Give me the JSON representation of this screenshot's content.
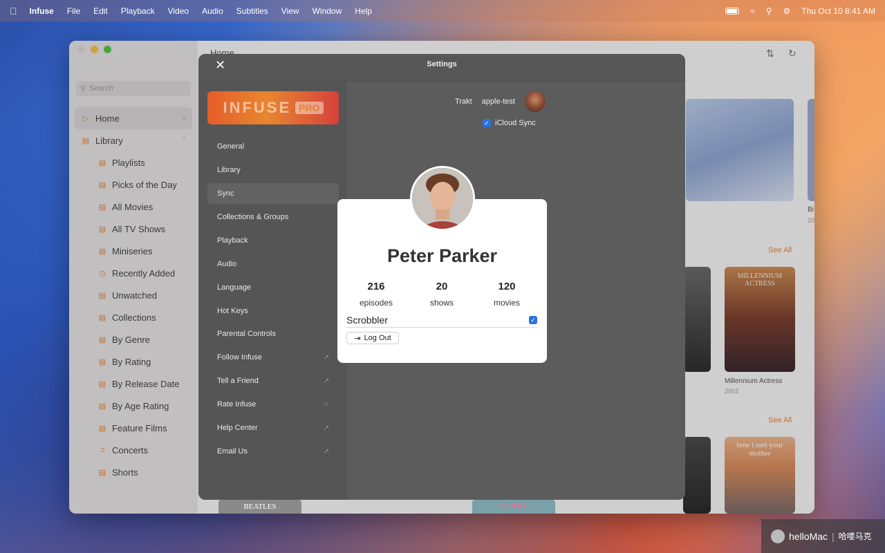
{
  "menubar": {
    "app": "Infuse",
    "items": [
      "File",
      "Edit",
      "Playback",
      "Video",
      "Audio",
      "Subtitles",
      "View",
      "Window",
      "Help"
    ],
    "clock": "Thu Oct 10  8:41 AM"
  },
  "sidebar": {
    "search_placeholder": "Search",
    "home": "Home",
    "library": "Library",
    "items": [
      "Playlists",
      "Picks of the Day",
      "All Movies",
      "All TV Shows",
      "Miniseries",
      "Recently Added",
      "Unwatched",
      "Collections",
      "By Genre",
      "By Rating",
      "By Release Date",
      "By Age Rating",
      "Feature Films",
      "Concerts",
      "Shorts"
    ]
  },
  "content": {
    "title": "Home",
    "see_all": "See All",
    "see_all_2": "See All",
    "posters": [
      {
        "title": "Millennium Actress",
        "year": "2002",
        "art_text": "MILLENNIUM ACTRESS"
      },
      {
        "art_text": "how i met your mother"
      },
      {
        "art_text": "BEATLES"
      },
      {
        "art_text": "the big C"
      }
    ],
    "cutoff_title": "Bi",
    "cutoff_year": "20"
  },
  "settings": {
    "title": "Settings",
    "banner": {
      "word": "INFUSE",
      "badge": "PRO"
    },
    "items": [
      {
        "label": "General",
        "icon": ""
      },
      {
        "label": "Library",
        "icon": ""
      },
      {
        "label": "Sync",
        "icon": "",
        "selected": true
      },
      {
        "label": "Collections & Groups",
        "icon": ""
      },
      {
        "label": "Playback",
        "icon": ""
      },
      {
        "label": "Audio",
        "icon": ""
      },
      {
        "label": "Language",
        "icon": ""
      },
      {
        "label": "Hot Keys",
        "icon": ""
      },
      {
        "label": "Parental Controls",
        "icon": ""
      },
      {
        "label": "Follow Infuse",
        "icon": "external-link-icon"
      },
      {
        "label": "Tell a Friend",
        "icon": "external-link-icon"
      },
      {
        "label": "Rate Infuse",
        "icon": "star-icon"
      },
      {
        "label": "Help Center",
        "icon": "external-link-icon"
      },
      {
        "label": "Email Us",
        "icon": "external-link-icon"
      }
    ],
    "trakt_label": "Trakt",
    "trakt_user": "apple-test",
    "icloud_label": "iCloud Sync",
    "icloud_checked": true
  },
  "profile": {
    "name": "Peter Parker",
    "stats": [
      {
        "num": "216",
        "label": "episodes"
      },
      {
        "num": "20",
        "label": "shows"
      },
      {
        "num": "120",
        "label": "movies"
      }
    ],
    "scrobbler_label": "Scrobbler",
    "scrobbler_checked": true,
    "logout_label": "Log Out"
  },
  "watermark": {
    "brand": "helloMac",
    "cn": "哈喽马克"
  },
  "colors": {
    "accent": "#e4843a",
    "checkbox": "#2a72e0"
  }
}
